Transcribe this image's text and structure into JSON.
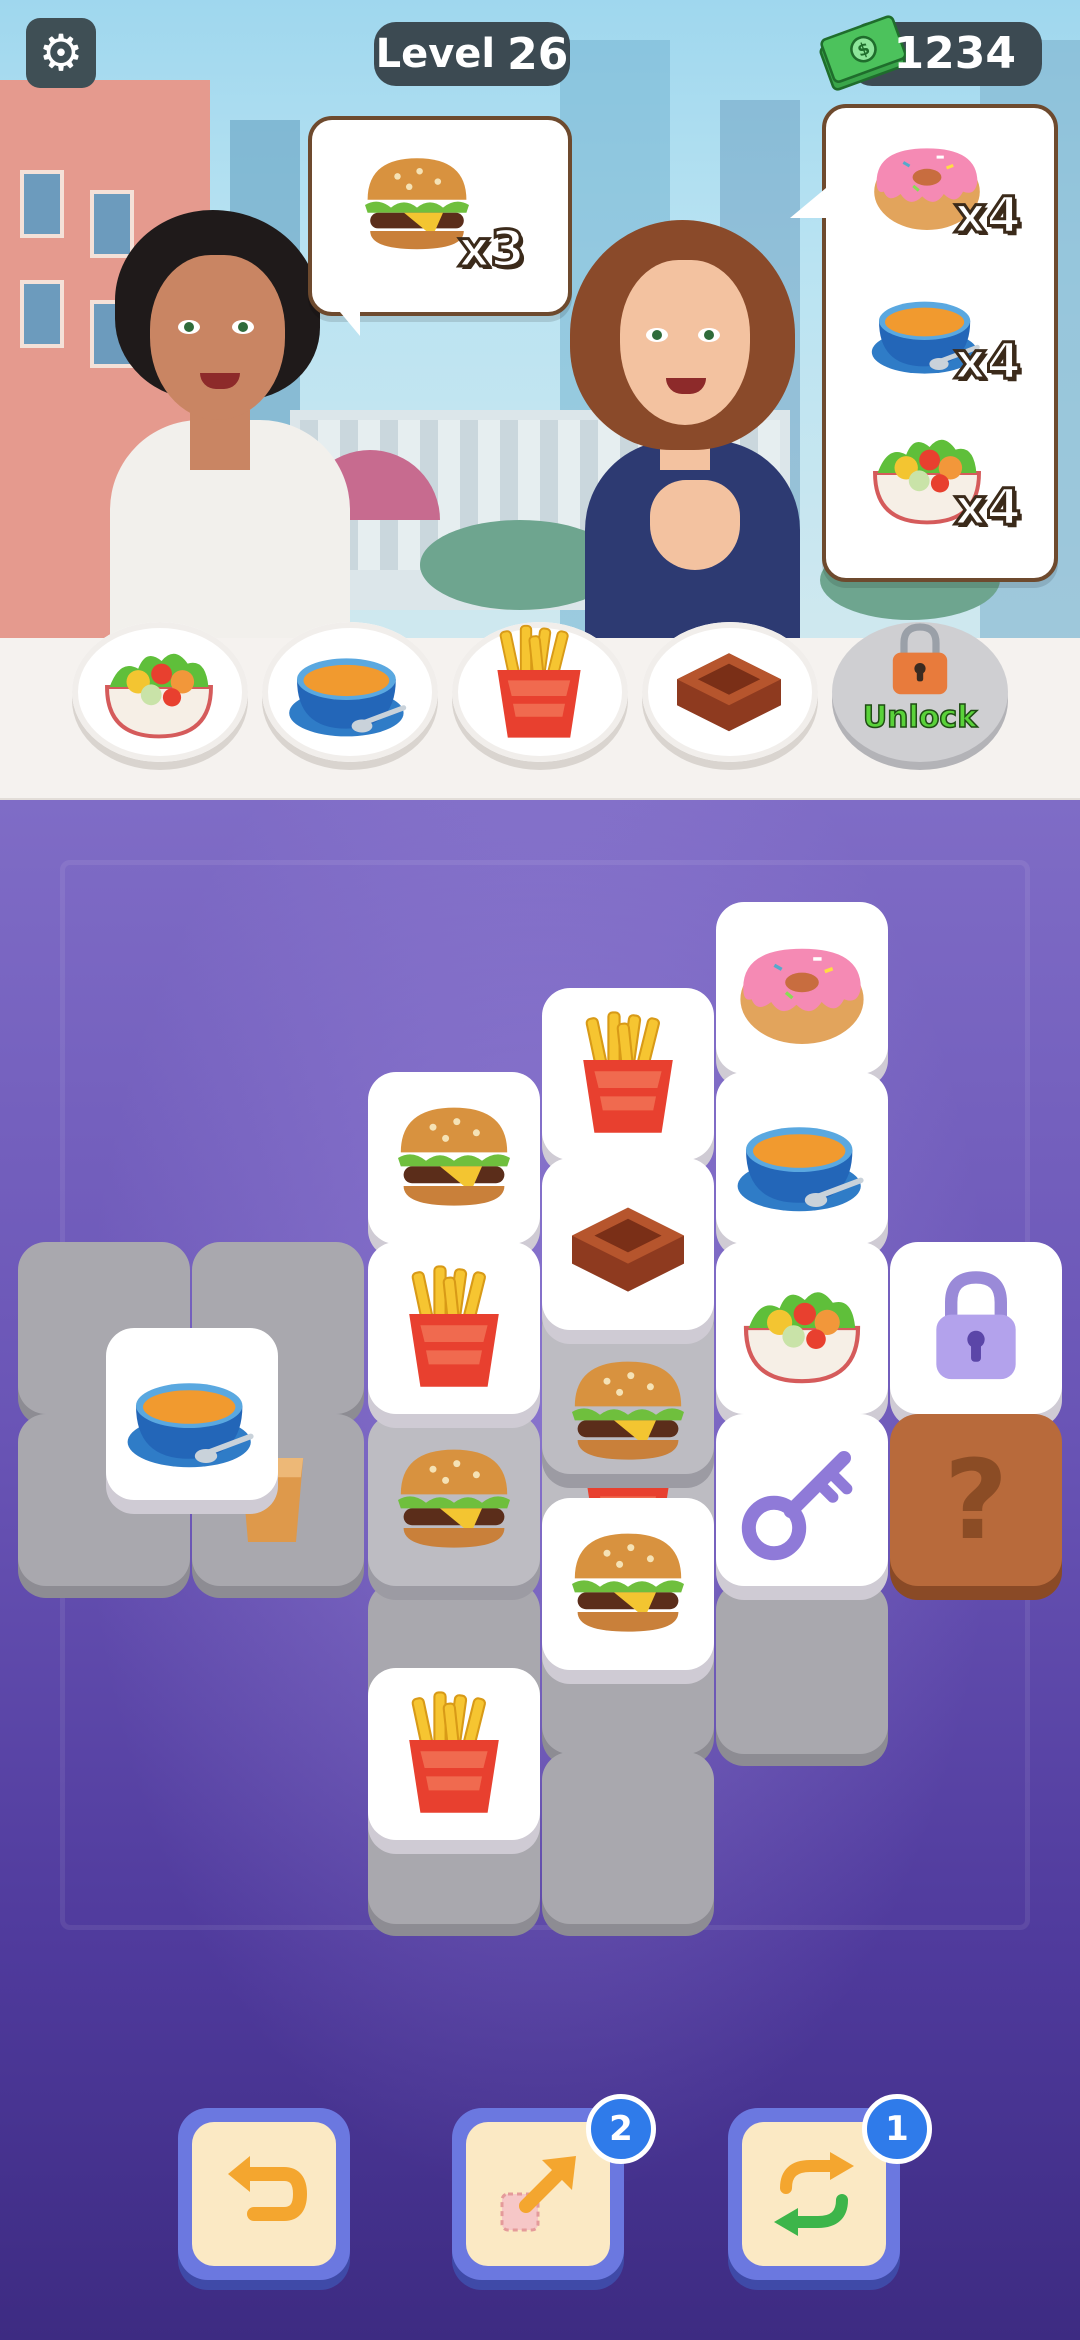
{
  "hud": {
    "settings_icon": "gear-icon",
    "level_label": "Level",
    "level_number": "26",
    "cash_icon": "cash-bundle-icon",
    "cash": "1234"
  },
  "orders": {
    "left_customer": {
      "items": [
        {
          "food": "burger",
          "count": "x3"
        }
      ]
    },
    "right_customer": {
      "items": [
        {
          "food": "donut",
          "count": "x4"
        },
        {
          "food": "soup",
          "count": "x4"
        },
        {
          "food": "fruit-salad",
          "count": "x4"
        }
      ]
    }
  },
  "counter": {
    "plates": [
      "fruit-salad",
      "soup",
      "fries",
      "chocolate",
      "locked"
    ],
    "unlock_label": "Unlock"
  },
  "board": {
    "tiles": [
      "donut",
      "fries",
      "burger",
      "soup",
      "chocolate",
      "fries",
      "fruit-salad",
      "lock",
      "soup",
      "burger",
      "key",
      "mystery",
      "burger",
      "fries"
    ],
    "hidden_items": [
      "juice",
      "fries",
      "burger"
    ]
  },
  "powerups": {
    "undo": {
      "icon": "undo-arrow-icon"
    },
    "magic": {
      "icon": "diagonal-arrow-icon",
      "count": "2"
    },
    "shuffle": {
      "icon": "shuffle-arrows-icon",
      "count": "1"
    }
  },
  "colors": {
    "accent": "#2f7bea",
    "board_top": "#7f6cc6",
    "board_bottom": "#3d2b82",
    "pill": "#3c4a52"
  }
}
